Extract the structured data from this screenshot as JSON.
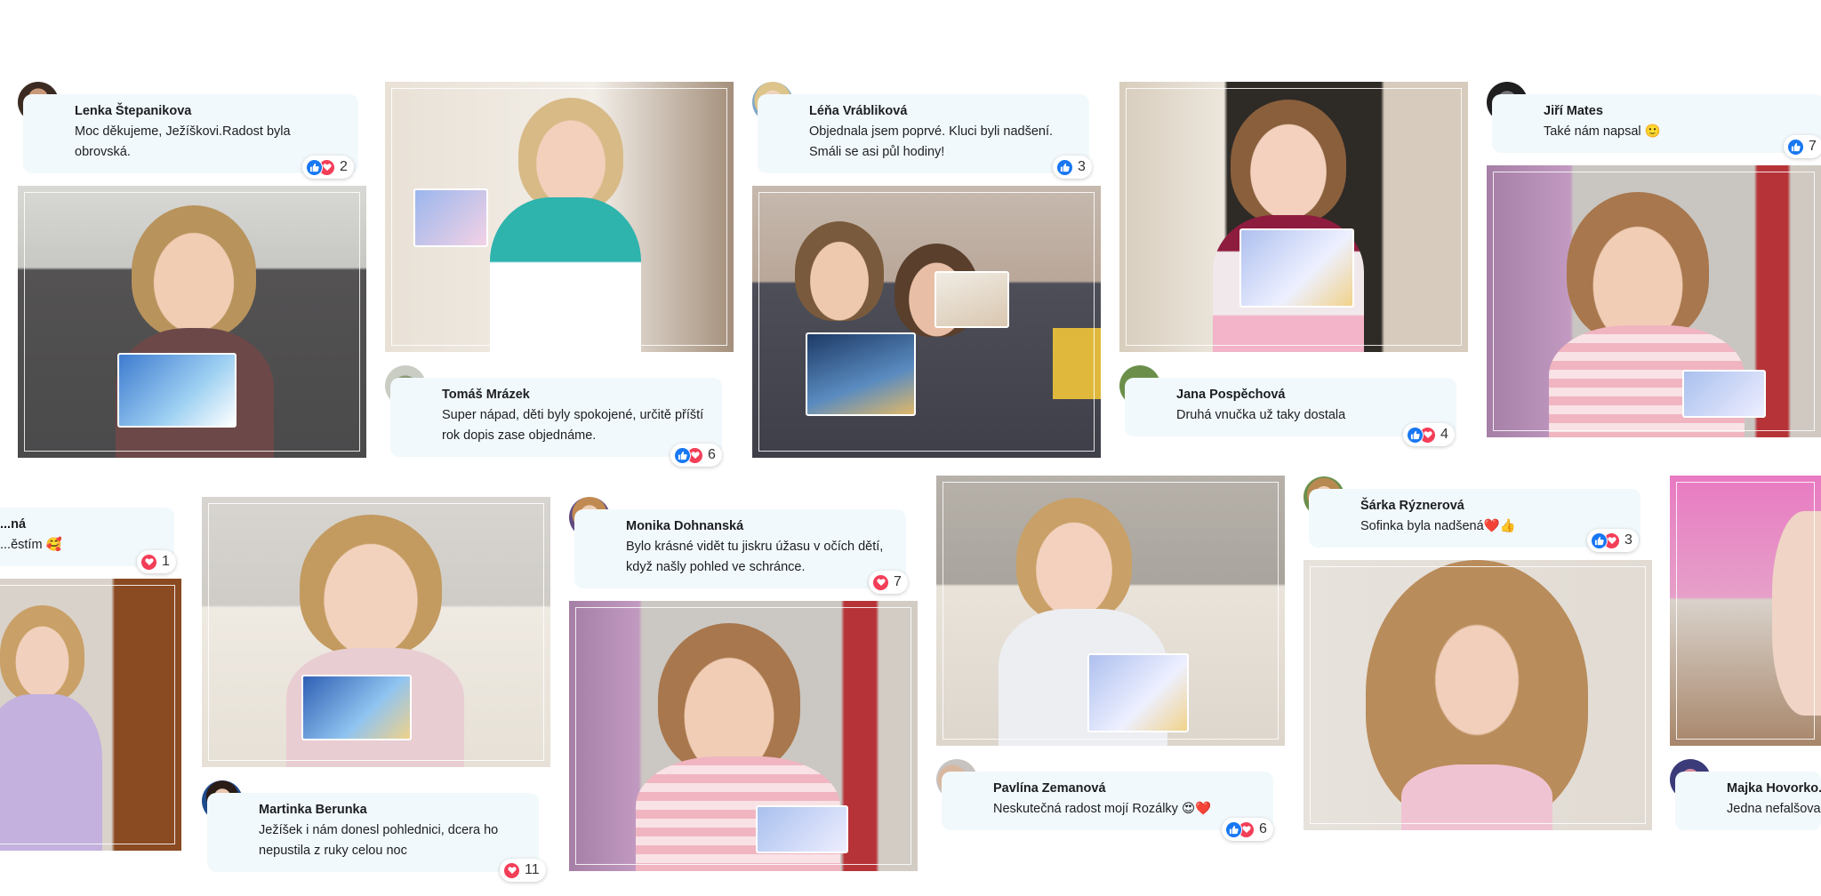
{
  "icons": {
    "like": "thumbs-up-icon",
    "love": "heart-icon",
    "source": "facebook-icon"
  },
  "colors": {
    "bubble": "#f2f9fc",
    "facebook": "#1877f2",
    "love": "#f33e58",
    "photo_frame": "#e8dcc8"
  },
  "comments": [
    {
      "name": "Lenka Štepanikova",
      "text": "Moc děkujeme, Ježíškovi.Radost byla obrovská.",
      "count": "2"
    },
    {
      "name": "Tomáš Mrázek",
      "text": "Super nápad, děti byly spokojené, určitě příští rok dopis zase objednáme.",
      "count": "6"
    },
    {
      "name": "Léňa Vrábliková",
      "text": "Objednala jsem poprvé. Kluci byli nadšení. Smáli se asi půl hodiny!",
      "count": "3"
    },
    {
      "name": "Jana Pospěchová",
      "text": "Druhá vnučka už taky dostala",
      "count": "4"
    },
    {
      "name": "Jiří Mates",
      "text": "Také nám napsal 🙂",
      "count": "7"
    },
    {
      "name": "...ná",
      "text": "...ěstím 🥰",
      "count": "1"
    },
    {
      "name": "Martinka Berunka",
      "text": "Ježíšek i nám donesl pohlednici, dcera ho nepustila z ruky celou noc",
      "count": "11"
    },
    {
      "name": "Monika Dohnanská",
      "text": "Bylo krásné vidět tu jiskru úžasu v očích dětí, když našly pohled ve schránce.",
      "count": "7"
    },
    {
      "name": "Pavlína Zemanová",
      "text": "Neskutečná radost mojí Rozálky 😍❤️",
      "count": "6"
    },
    {
      "name": "Šárka Rýznerová",
      "text": "Sofinka byla nadšená❤️👍",
      "count": "3"
    },
    {
      "name": "Majka Hovorko...",
      "text": "Jedna nefalšova...",
      "count": ""
    }
  ]
}
